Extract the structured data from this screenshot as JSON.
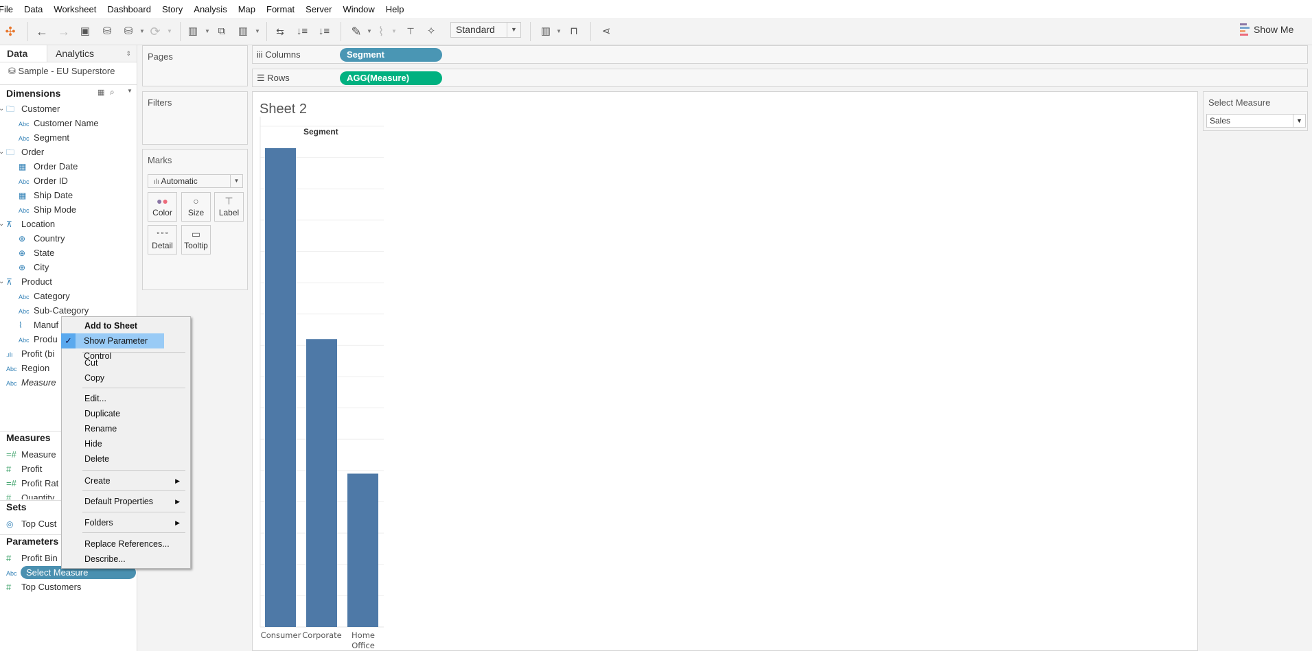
{
  "menubar": [
    "File",
    "Data",
    "Worksheet",
    "Dashboard",
    "Story",
    "Analysis",
    "Map",
    "Format",
    "Server",
    "Window",
    "Help"
  ],
  "toolbar": {
    "fit_mode": "Standard",
    "show_me": "Show Me"
  },
  "data_pane": {
    "tabs": {
      "data": "Data",
      "analytics": "Analytics"
    },
    "datasource": "Sample - EU Superstore",
    "dimensions_header": "Dimensions",
    "dimensions": [
      {
        "label": "Customer",
        "icon": "folder-icon",
        "level": 0,
        "folder": true
      },
      {
        "label": "Customer Name",
        "icon": "abc-icon",
        "level": 1
      },
      {
        "label": "Segment",
        "icon": "abc-icon",
        "level": 1
      },
      {
        "label": "Order",
        "icon": "folder-icon",
        "level": 0,
        "folder": true
      },
      {
        "label": "Order Date",
        "icon": "calendar-icon",
        "level": 1
      },
      {
        "label": "Order ID",
        "icon": "abc-icon",
        "level": 1
      },
      {
        "label": "Ship Date",
        "icon": "calendar-icon",
        "level": 1
      },
      {
        "label": "Ship Mode",
        "icon": "abc-icon",
        "level": 1
      },
      {
        "label": "Location",
        "icon": "hierarchy-icon",
        "level": 0,
        "folder": true
      },
      {
        "label": "Country",
        "icon": "globe-icon",
        "level": 1
      },
      {
        "label": "State",
        "icon": "globe-icon",
        "level": 1
      },
      {
        "label": "City",
        "icon": "globe-icon",
        "level": 1
      },
      {
        "label": "Product",
        "icon": "hierarchy-icon",
        "level": 0,
        "folder": true
      },
      {
        "label": "Category",
        "icon": "abc-icon",
        "level": 1
      },
      {
        "label": "Sub-Category",
        "icon": "abc-icon",
        "level": 1
      },
      {
        "label": "Manuf",
        "icon": "paperclip-icon",
        "level": 1
      },
      {
        "label": "Produ",
        "icon": "abc-icon",
        "level": 1
      },
      {
        "label": "Profit (bi",
        "icon": "bin-icon",
        "level": 0
      },
      {
        "label": "Region",
        "icon": "abc-icon",
        "level": 0
      },
      {
        "label": "Measure",
        "icon": "abc-icon",
        "level": 0,
        "italic": true
      }
    ],
    "measures_header": "Measures",
    "measures": [
      {
        "label": "Measure",
        "icon": "calc-number-icon"
      },
      {
        "label": "Profit",
        "icon": "number-icon"
      },
      {
        "label": "Profit Rat",
        "icon": "calc-number-icon"
      },
      {
        "label": "Quantity",
        "icon": "number-icon"
      }
    ],
    "sets_header": "Sets",
    "sets": [
      {
        "label": "Top Cust",
        "icon": "set-icon"
      }
    ],
    "parameters_header": "Parameters",
    "parameters": [
      {
        "label": "Profit Bin",
        "icon": "number-icon"
      },
      {
        "label": "Select Measure",
        "icon": "abc-icon",
        "selected": true
      },
      {
        "label": "Top Customers",
        "icon": "number-icon"
      }
    ]
  },
  "cards": {
    "pages": "Pages",
    "filters": "Filters",
    "marks": "Marks",
    "mark_type": "Automatic",
    "buttons": [
      "Color",
      "Size",
      "Label",
      "Detail",
      "Tooltip"
    ]
  },
  "shelves": {
    "columns_label": "Columns",
    "columns_pill": "Segment",
    "rows_label": "Rows",
    "rows_pill": "AGG(Measure)"
  },
  "colors": {
    "dimension_pill": "#4a96b4",
    "measure_pill": "#00b180",
    "bar": "#4e79a7",
    "selected_param": "#4a90b0"
  },
  "context_menu": [
    {
      "label": "Add to Sheet",
      "bold": true
    },
    {
      "label": "Show Parameter Control",
      "checked": true,
      "highlighted": true
    },
    {
      "sep": true
    },
    {
      "label": "Cut"
    },
    {
      "label": "Copy"
    },
    {
      "sep": true
    },
    {
      "label": "Edit..."
    },
    {
      "label": "Duplicate"
    },
    {
      "label": "Rename"
    },
    {
      "label": "Hide"
    },
    {
      "label": "Delete"
    },
    {
      "sep": true
    },
    {
      "label": "Create",
      "submenu": true
    },
    {
      "sep": true
    },
    {
      "label": "Default Properties",
      "submenu": true
    },
    {
      "sep": true
    },
    {
      "label": "Folders",
      "submenu": true
    },
    {
      "sep": true
    },
    {
      "label": "Replace References..."
    },
    {
      "label": "Describe..."
    }
  ],
  "sheet": {
    "title": "Sheet 2"
  },
  "parameter_control": {
    "title": "Select Measure",
    "value": "Sales"
  },
  "chart_data": {
    "type": "bar",
    "title": "Sheet 2",
    "header": "Segment",
    "categories": [
      "Consumer",
      "Corporate",
      "Home Office"
    ],
    "values": [
      1530000,
      920000,
      490000
    ],
    "xlabel": "Segment",
    "ylabel": "AGG(Measure)",
    "ylim": [
      0,
      1600000
    ],
    "grid": true
  }
}
